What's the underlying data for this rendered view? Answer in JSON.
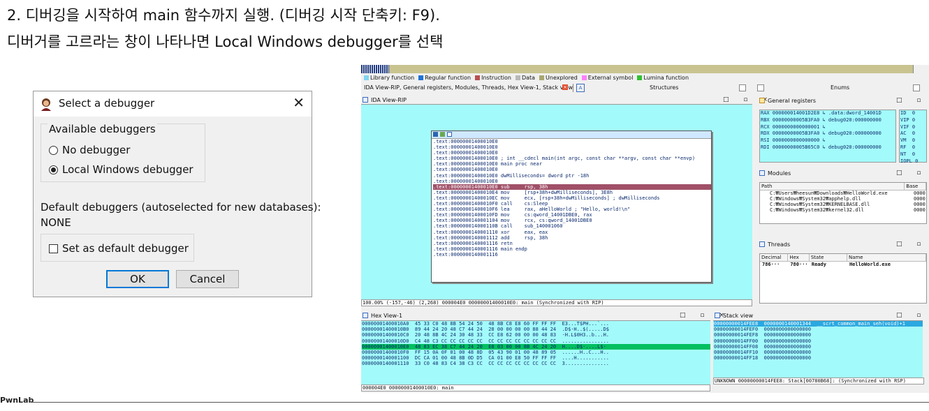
{
  "captions": {
    "line1": "2. 디버깅을 시작하여 main 함수까지 실행. (디버깅 시작 단축키: F9).",
    "line2": "디버거를 고르라는 창이 나타나면 Local Windows debugger를 선택"
  },
  "dialog": {
    "title": "Select a debugger",
    "close": "✕",
    "group_label": "Available debuggers",
    "options": [
      "No debugger",
      "Local Windows debugger"
    ],
    "selected_option": "Local Windows debugger",
    "default_label": "Default debuggers (autoselected for new databases):",
    "default_value": "NONE",
    "checkbox_label": "Set as default debugger",
    "checkbox_checked": false,
    "ok": "OK",
    "cancel": "Cancel"
  },
  "ida": {
    "legend": [
      "Library function",
      "Regular function",
      "Instruction",
      "Data",
      "Unexplored",
      "External symbol",
      "Lumina function"
    ],
    "legend_colors": [
      "#7fd6f0",
      "#1f73d6",
      "#b85050",
      "#b8b8b8",
      "#a8a870",
      "#ff80ff",
      "#30c030"
    ],
    "tabs_text": "IDA View-RIP, General registers, Modules, Threads, Hex View-1, Stack view",
    "structures": "Structures",
    "enums": "Enums",
    "ida_view_title": "IDA View-RIP",
    "gen_regs_title": "General registers",
    "modules_title": "Modules",
    "threads_title": "Threads",
    "hex_title": "Hex View-1",
    "stack_title": "Stack view",
    "window_controls": "□ ▫ ×",
    "disasm": [
      ".text:00000001400010E0",
      ".text:00000001400010E0",
      ".text:00000001400010E0",
      ".text:00000001400010E0 ; int __cdecl main(int argc, const char **argv, const char **envp)",
      ".text:00000001400010E0 main proc near",
      ".text:00000001400010E0",
      ".text:00000001400010E0 dwMilliseconds= dword ptr -18h",
      ".text:00000001400010E0",
      ".text:00000001400010E0 sub     rsp, 38h",
      ".text:00000001400010E4 mov     [rsp+38h+dwMilliseconds], 3E8h",
      ".text:00000001400010EC mov     ecx, [rsp+38h+dwMilliseconds] ; dwMilliseconds",
      ".text:00000001400010F0 call    cs:Sleep",
      ".text:00000001400010F6 lea     rax, aHelloWorld ; \"Hello, world!\\n\"",
      ".text:00000001400010FD mov     cs:qword_14001DBE0, rax",
      ".text:0000000140001104 mov     rcx, cs:qword_14001DBE0",
      ".text:000000014000110B call    sub_140001060",
      ".text:0000000140001110 xor     eax, eax",
      ".text:0000000140001112 add     rsp, 38h",
      ".text:0000000140001116 retn",
      ".text:0000000140001116 main endp",
      ".text:0000000140001116"
    ],
    "disasm_highlight_index": 8,
    "graph_status": "100.00% (-157,-46) (2,268) 000004E0 00000001400010E0: main (Synchronized with RIP)",
    "registers": [
      "RAX 000000014001D2E8 ↳ .data:dword_14001D",
      "RBX 00000000005B3FA0 ↳ debug020:000000000",
      "RCX 0000000000000001 ↳",
      "RDX 00000000005B3FA0 ↳ debug020:000000000",
      "RSI 0000000000000000 ↳",
      "RDI 00000000005B65C0 ↳ debug020:000000000"
    ],
    "flags": [
      "ID  0",
      "VIP 0",
      "VIF 0",
      "AC  0",
      "VM  0",
      "RF  0",
      "NT  0",
      "IOPL 0"
    ],
    "modules_cols": [
      "Path",
      "Base"
    ],
    "modules_rows": [
      [
        "C:₩Users₩heesun₩Downloads₩HelloWorld.exe",
        "0000"
      ],
      [
        "C:₩Windows₩System32₩apphelp.dll",
        "0000"
      ],
      [
        "C:₩Windows₩System32₩KERNELBASE.dll",
        "0000"
      ],
      [
        "C:₩Windows₩System32₩kernel32.dll",
        "0000"
      ]
    ],
    "threads_cols": [
      "Decimal",
      "Hex",
      "State",
      "Name"
    ],
    "threads_rows": [
      [
        "786···",
        "780···",
        "Ready",
        "HelloWorld.exe"
      ]
    ],
    "hex_lines": [
      "00000001400010A0  45 33 C0 48 8B 54 24 50  48 8B C8 E8 60 FF FF FF  E3...T$PH...`...",
      "00000001400010B0  89 44 24 20 48 C7 44 24  28 00 00 00 00 88 44 24  .D$·H..$(.....D$",
      "00000001400010C0  20 48 8B 4C 24 30 48 33  CC E8 62 00 00 00 48 83  ·H.L$0H3..b...H.",
      "00000001400010D0  C4 48 C3 CC CC CC CC CC  CC CC CC CC CC CC CC CC  ................",
      "00000001400010E0  48 83 EC 38 C7 44 24 20  E8 03 00 00 8B 4C 24 20  H....D$·....L$·",
      "00000001400010F0  FF 15 0A 0F 01 00 48 8D  05 43 90 01 00 48 89 05  ......H..C...H..",
      "0000000140001100  DC CA 01 00 48 8B 0D D5  CA 01 00 E8 50 FF FF FF  ....H...........",
      "0000000140001110  33 C0 48 83 C4 38 C3 CC  CC CC CC CC CC CC CC CC  3..............."
    ],
    "hex_highlight_index": 4,
    "hex_status": "000004E0 00000001400010E0: main",
    "stack_lines": [
      "00000000014FEE8  0000000140001344  __scrt_common_main_seh(void)+1",
      "00000000014FEF0  0000000000000000",
      "00000000014FEF8  0000000000000000",
      "00000000014FF00  0000000000000000",
      "00000000014FF08  0000000000000000",
      "00000000014FF10  0000000000000000",
      "00000000014FF18  0000000000000000"
    ],
    "stack_highlight_index": 0,
    "stack_status": "UNKNOWN 00000000014FEE8: Stack[00780B68]: (Synchronized with RSP)"
  },
  "footer": {
    "brand": "PwnLab"
  }
}
